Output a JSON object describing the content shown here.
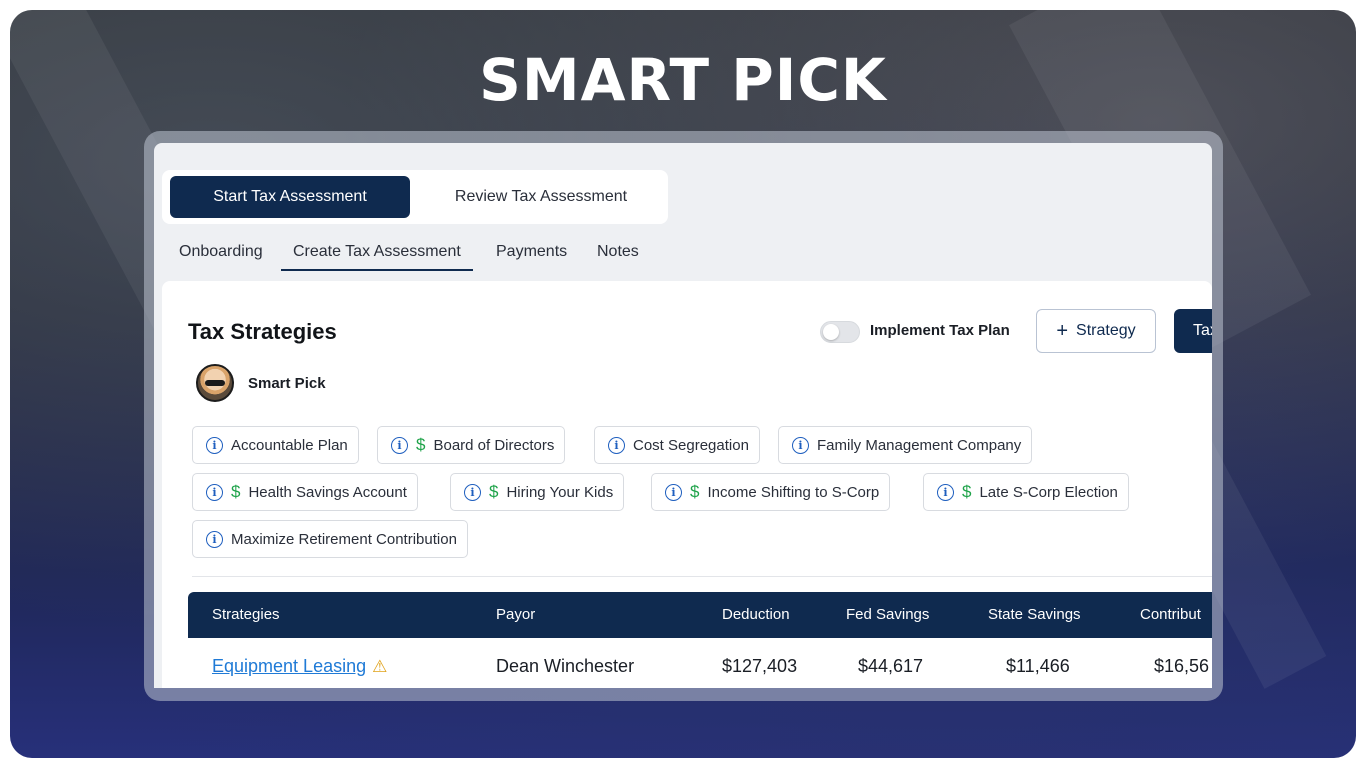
{
  "hero": {
    "title": "SMART PICK"
  },
  "assessment_toggle": {
    "start_label": "Start Tax Assessment",
    "review_label": "Review Tax Assessment"
  },
  "tabs": [
    {
      "label": "Onboarding"
    },
    {
      "label": "Create Tax Assessment"
    },
    {
      "label": "Payments"
    },
    {
      "label": "Notes"
    }
  ],
  "panel": {
    "title": "Tax Strategies",
    "implement_label": "Implement Tax Plan",
    "implement_on": false,
    "add_strategy_label": "Strategy",
    "primary_button_label": "Tax",
    "smart_pick_label": "Smart Pick"
  },
  "chips": [
    {
      "label": "Accountable Plan",
      "dollar": false
    },
    {
      "label": "Board of Directors",
      "dollar": true
    },
    {
      "label": "Cost Segregation",
      "dollar": false
    },
    {
      "label": "Family Management Company",
      "dollar": false
    },
    {
      "label": "Health Savings Account",
      "dollar": true
    },
    {
      "label": "Hiring Your Kids",
      "dollar": true
    },
    {
      "label": "Income Shifting to S-Corp",
      "dollar": true
    },
    {
      "label": "Late S-Corp Election",
      "dollar": true
    },
    {
      "label": "Maximize Retirement Contribution",
      "dollar": false
    }
  ],
  "table": {
    "columns": [
      "Strategies",
      "Payor",
      "Deduction",
      "Fed Savings",
      "State Savings",
      "Contribut"
    ],
    "rows": [
      {
        "strategy": "Equipment Leasing",
        "payor": "Dean Winchester",
        "deduction": "$127,403",
        "fed_savings": "$44,617",
        "state_savings": "$11,466",
        "contribution": "$16,56"
      }
    ]
  },
  "icons": {
    "info": "info-icon",
    "dollar": "dollar-icon",
    "warning": "warning-icon",
    "plus": "plus-icon"
  },
  "colors": {
    "navy": "#0f2a4f",
    "link_blue": "#1f7ad6",
    "dollar_green": "#1fa34a",
    "warning_amber": "#e0a21a"
  }
}
